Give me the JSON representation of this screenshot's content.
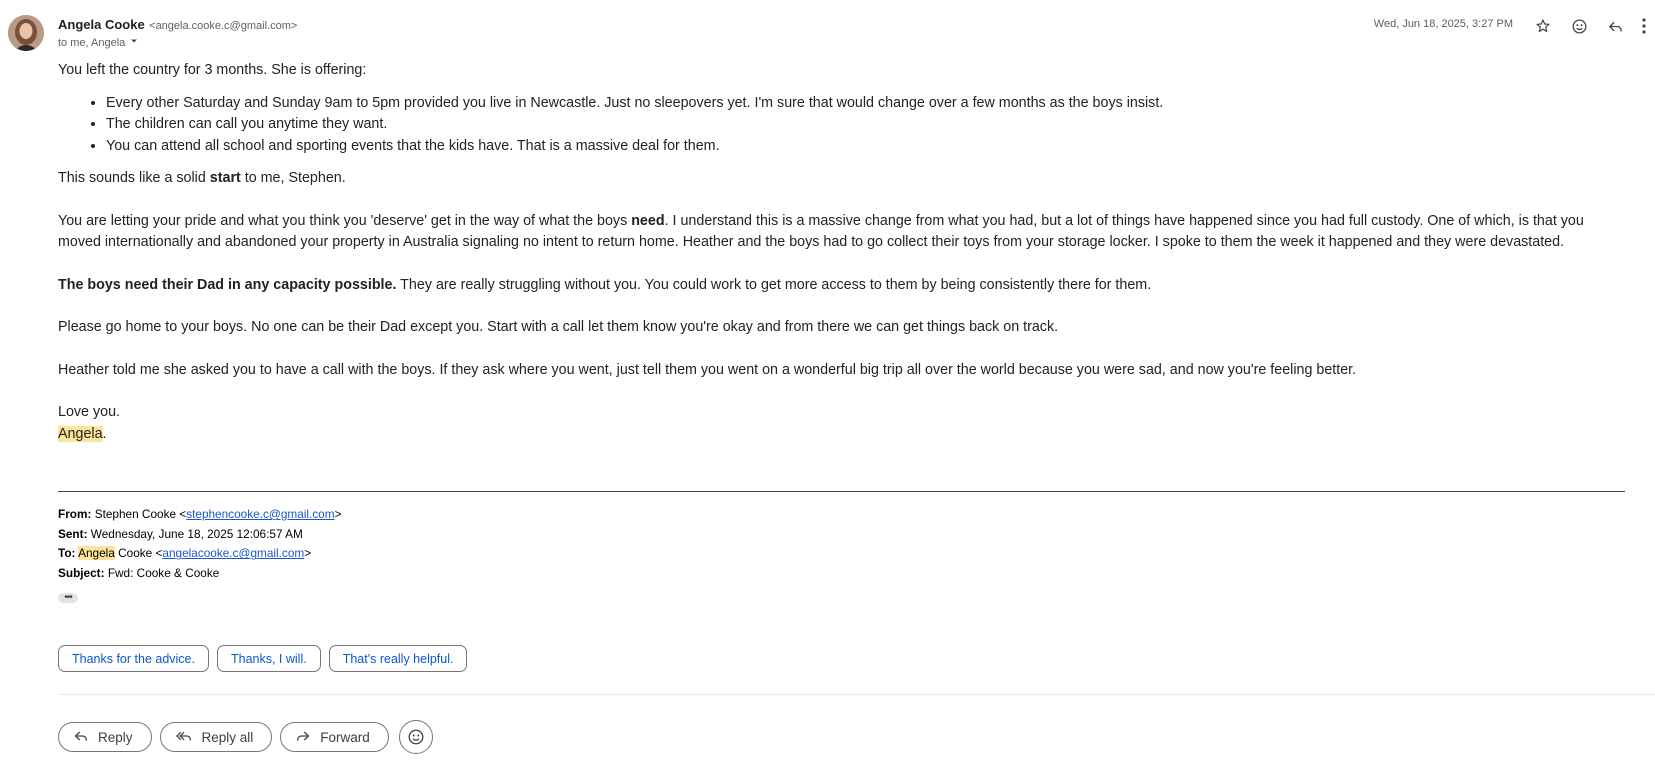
{
  "sender": {
    "name": "Angela Cooke",
    "email": "<angela.cooke.c@gmail.com>",
    "to_line": "to me, Angela",
    "date": "Wed, Jun 18, 2025, 3:27 PM"
  },
  "body": {
    "p1": "You left the country for 3 months. She is offering:",
    "bullets": [
      "Every other Saturday and Sunday 9am to 5pm provided you live in Newcastle. Just no sleepovers yet. I'm sure that would change over a few months as the boys insist.",
      "The children can call you anytime they want.",
      "You can attend all school and sporting events that the kids have. That is a massive deal for them."
    ],
    "p2_a": "This sounds like a solid ",
    "p2_bold": "start",
    "p2_b": " to me, Stephen.",
    "p3_a": "You are letting your pride and what you think you 'deserve' get in the way of what the boys ",
    "p3_bold": "need",
    "p3_b": ". I understand this is a massive change from what you had, but a lot of things have happened since you had full custody. One of which, is that you moved internationally and abandoned your property in Australia signaling no intent to return home. Heather and the boys had to go collect their toys from your storage locker. I spoke to them the week it happened and they were devastated.",
    "p4_bold": "The boys need their Dad in any capacity possible.",
    "p4_b": " They are really struggling without you. You could work to get more access to them by being consistently there for them.",
    "p5": "Please go home to your boys. No one can be their Dad except you. Start with a call let them know you're okay and from there we can get things back on track.",
    "p6": "Heather told me she asked you to have a call with the boys. If they ask where you went, just tell them you went on a wonderful big trip all over the world because you were sad, and now you're feeling better.",
    "signoff": "Love you.",
    "signature": "Angela",
    "signature_punct": "."
  },
  "quoted": {
    "from_label": "From:",
    "from_name": "Stephen Cooke <",
    "from_email": "stephencooke.c@gmail.com",
    "from_close": ">",
    "sent_label": "Sent:",
    "sent_value": "Wednesday, June 18, 2025 12:06:57 AM",
    "to_label": "To:",
    "to_highlight": "Angela",
    "to_name_rest": " Cooke <",
    "to_email": "angelacooke.c@gmail.com",
    "to_close": ">",
    "subject_label": "Subject:",
    "subject_value": "Fwd: Cooke & Cooke",
    "ellipsis": "•••"
  },
  "suggestions": [
    "Thanks for the advice.",
    "Thanks, I will.",
    "That's really helpful."
  ],
  "actions": {
    "reply": "Reply",
    "reply_all": "Reply all",
    "forward": "Forward"
  },
  "colors": {
    "link": "#0b57d0",
    "highlight": "#fce59a"
  }
}
